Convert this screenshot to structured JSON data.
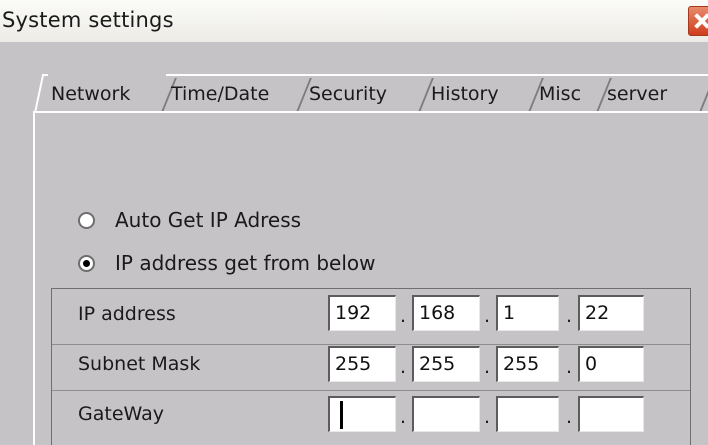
{
  "window": {
    "title": "System settings"
  },
  "tabs": [
    {
      "label": "Network",
      "active": true
    },
    {
      "label": "Time/Date",
      "active": false
    },
    {
      "label": "Security",
      "active": false
    },
    {
      "label": "History",
      "active": false
    },
    {
      "label": "Misc",
      "active": false
    },
    {
      "label": "server",
      "active": false
    }
  ],
  "network": {
    "ip_mode_options": [
      {
        "label": "Auto Get IP Adress",
        "selected": false
      },
      {
        "label": "IP address get from below",
        "selected": true
      }
    ],
    "fields": [
      {
        "label": "IP address",
        "octets": [
          "192",
          "168",
          "1",
          "22"
        ]
      },
      {
        "label": "Subnet Mask",
        "octets": [
          "255",
          "255",
          "255",
          "0"
        ]
      },
      {
        "label": "GateWay",
        "octets": [
          "",
          "",
          "",
          ""
        ]
      }
    ],
    "separator": "."
  }
}
